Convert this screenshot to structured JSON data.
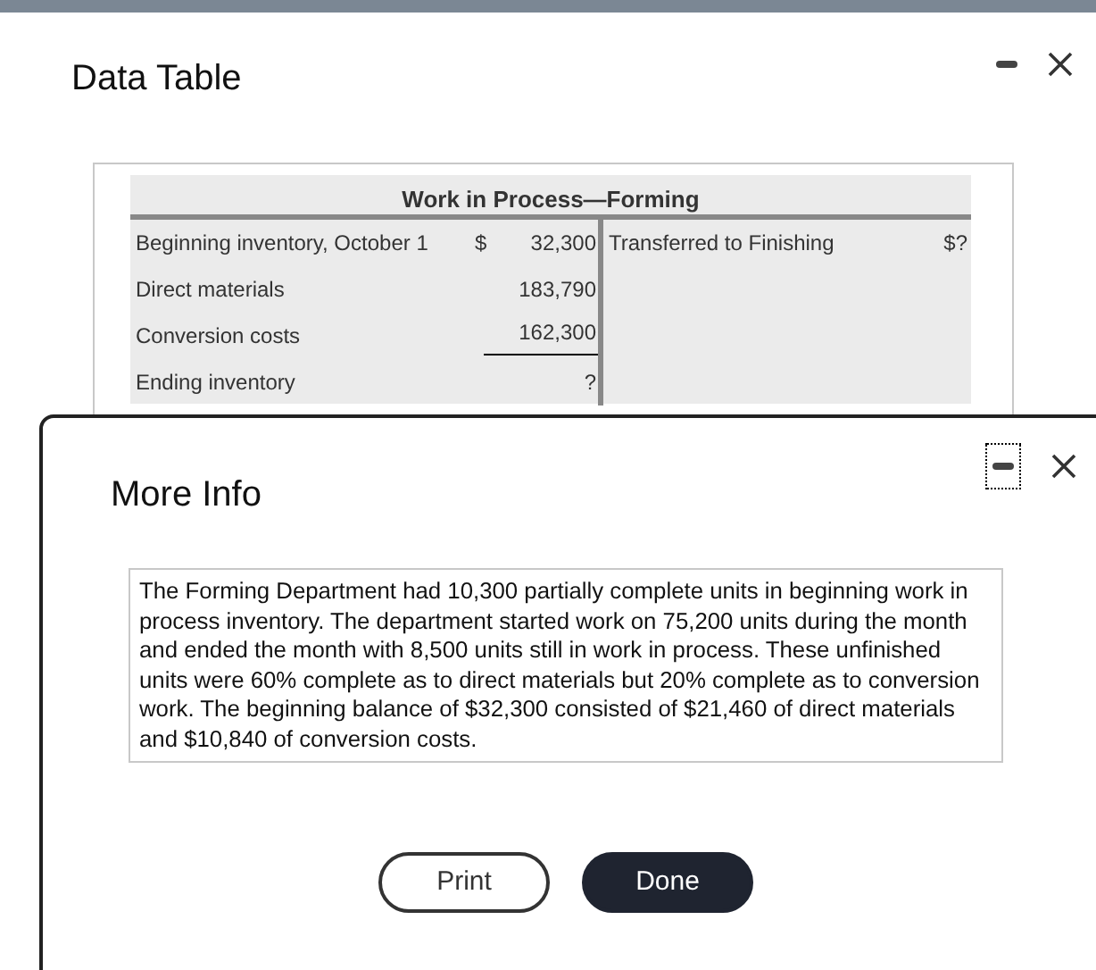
{
  "data_table_dialog": {
    "title": "Data Table",
    "table": {
      "title": "Work in Process—Forming",
      "rows": [
        {
          "left_label": "Beginning inventory, October 1",
          "currency": "$",
          "left_amount": "32,300",
          "right_label": "Transferred to Finishing",
          "right_amount": "$?",
          "underline": false
        },
        {
          "left_label": "Direct materials",
          "left_amount": "183,790",
          "underline": false
        },
        {
          "left_label": "Conversion costs",
          "left_amount": "162,300",
          "underline": true
        },
        {
          "left_label": "Ending inventory",
          "left_amount": "?",
          "underline": false
        }
      ]
    }
  },
  "more_info_dialog": {
    "title": "More Info",
    "text": "The Forming Department had 10,300 partially complete units in beginning work in process inventory. The department started work on 75,200 units during the month and ended the month with 8,500 units still in work in process. These unfinished units were 60% complete as to direct materials but 20% complete as to conversion work. The beginning balance of $32,300 consisted of $21,460 of direct materials and $10,840 of conversion costs.",
    "buttons": [
      {
        "label": "Print",
        "kind": "secondary"
      },
      {
        "label": "Done",
        "kind": "primary"
      }
    ]
  }
}
